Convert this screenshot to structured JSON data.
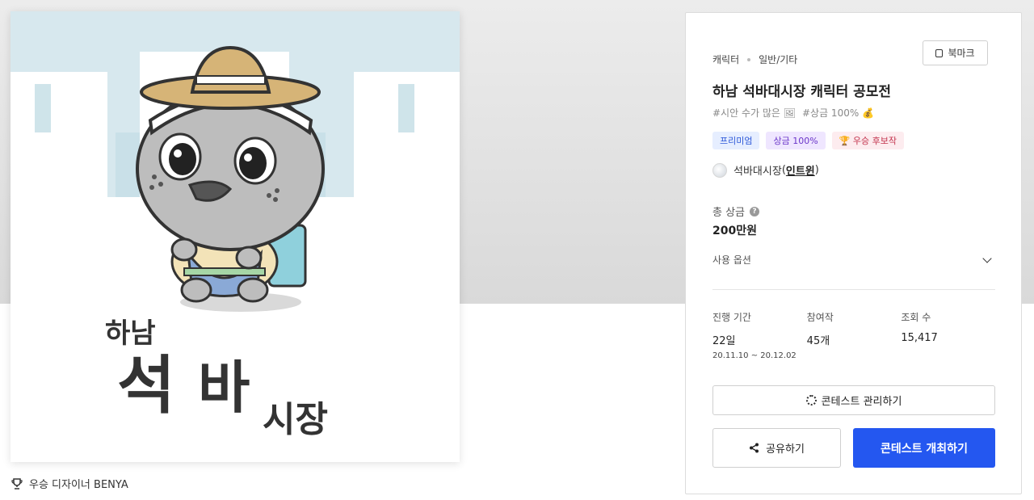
{
  "artwork": {
    "title_small": "하남",
    "title_big_1": "석",
    "title_big_2": "바",
    "title_big_3": "시장"
  },
  "winner": {
    "text": "우승 디자이너 BENYA"
  },
  "panel": {
    "category": "캐릭터",
    "subcategory": "일반/기타",
    "bookmark_label": "북마크",
    "title": "하남 석바대시장 캐릭터 공모전",
    "tags": [
      "#시안 수가 많은 🖼",
      "#상금 100% 💰"
    ],
    "badges": {
      "premium": "프리미엄",
      "prize": "상금 100%",
      "winner": "🏆 우승 후보작"
    },
    "host_name": "석바대시장",
    "host_link": "인트윈",
    "prize_label": "총 상금",
    "prize_help": "?",
    "prize_value": "200만원",
    "options_label": "사용 옵션",
    "stats": {
      "period_label": "진행 기간",
      "period_value": "22일",
      "period_range": "20.11.10 ~ 20.12.02",
      "entries_label": "참여작",
      "entries_value": "45개",
      "views_label": "조회 수",
      "views_value": "15,417"
    },
    "manage_label": "콘테스트 관리하기",
    "share_label": "공유하기",
    "host_button_label": "콘테스트 개최하기"
  },
  "colors": {
    "primary": "#2457f0",
    "sky": "#d7e8ee"
  }
}
